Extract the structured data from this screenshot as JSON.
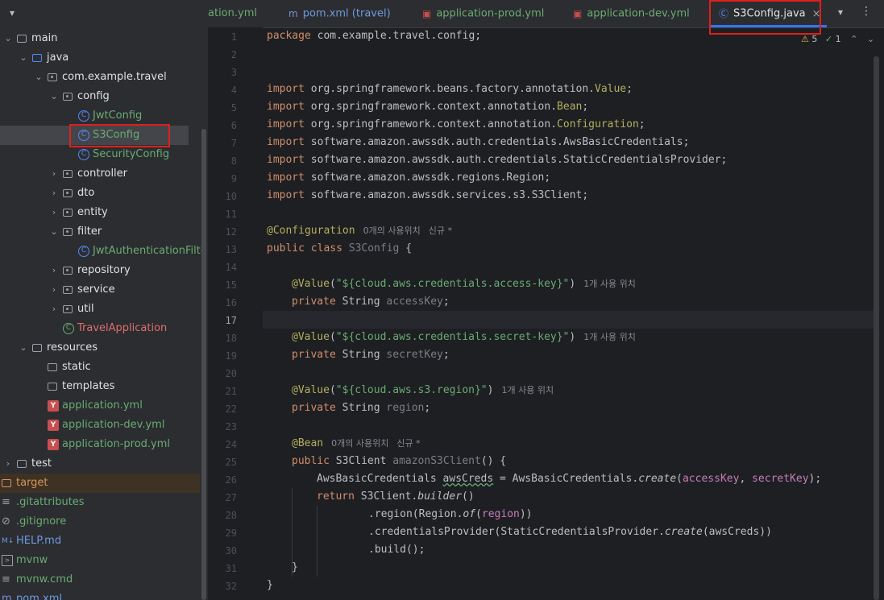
{
  "tabs": [
    {
      "label": "ation.yml",
      "icon": "yaml-file-icon",
      "active": false
    },
    {
      "label": "pom.xml (travel)",
      "icon": "maven-icon",
      "active": false
    },
    {
      "label": "application-prod.yml",
      "icon": "yaml-file-icon",
      "active": false
    },
    {
      "label": "application-dev.yml",
      "icon": "yaml-file-icon",
      "active": false
    },
    {
      "label": "S3Config.java",
      "icon": "java-class-icon",
      "active": true
    }
  ],
  "tree": [
    {
      "label": "main",
      "icon": "folder-icon",
      "expanded": true
    },
    {
      "label": "java",
      "icon": "source-folder-icon",
      "expanded": true
    },
    {
      "label": "com.example.travel",
      "icon": "package-icon",
      "expanded": true
    },
    {
      "label": "config",
      "icon": "package-icon",
      "expanded": true
    },
    {
      "label": "JwtConfig",
      "icon": "java-class-icon",
      "color": "green"
    },
    {
      "label": "S3Config",
      "icon": "java-class-icon",
      "color": "green",
      "selected": true
    },
    {
      "label": "SecurityConfig",
      "icon": "java-class-icon",
      "color": "green"
    },
    {
      "label": "controller",
      "icon": "package-icon",
      "expanded": false
    },
    {
      "label": "dto",
      "icon": "package-icon",
      "expanded": false
    },
    {
      "label": "entity",
      "icon": "package-icon",
      "expanded": false
    },
    {
      "label": "filter",
      "icon": "package-icon",
      "expanded": true
    },
    {
      "label": "JwtAuthenticationFilte",
      "icon": "java-class-icon",
      "color": "green"
    },
    {
      "label": "repository",
      "icon": "package-icon",
      "expanded": false
    },
    {
      "label": "service",
      "icon": "package-icon",
      "expanded": false
    },
    {
      "label": "util",
      "icon": "package-icon",
      "expanded": false
    },
    {
      "label": "TravelApplication",
      "icon": "spring-boot-icon",
      "color": "red"
    },
    {
      "label": "resources",
      "icon": "resources-folder-icon",
      "expanded": true
    },
    {
      "label": "static",
      "icon": "folder-icon"
    },
    {
      "label": "templates",
      "icon": "folder-icon"
    },
    {
      "label": "application.yml",
      "icon": "yaml-file-icon",
      "color": "green"
    },
    {
      "label": "application-dev.yml",
      "icon": "yaml-file-icon",
      "color": "green"
    },
    {
      "label": "application-prod.yml",
      "icon": "yaml-file-icon",
      "color": "green"
    },
    {
      "label": "test",
      "icon": "folder-icon",
      "expanded": false
    },
    {
      "label": "target",
      "icon": "excluded-folder-icon",
      "color": "orange"
    },
    {
      "label": ".gitattributes",
      "icon": "text-file-icon",
      "color": "green"
    },
    {
      "label": ".gitignore",
      "icon": "ignore-file-icon",
      "color": "green"
    },
    {
      "label": "HELP.md",
      "icon": "markdown-icon",
      "color": "blue"
    },
    {
      "label": "mvnw",
      "icon": "terminal-icon",
      "color": "green"
    },
    {
      "label": "mvnw.cmd",
      "icon": "text-file-icon",
      "color": "green"
    },
    {
      "label": "pom.xml",
      "icon": "maven-icon",
      "color": "blue"
    }
  ],
  "inspections": {
    "warnings": "5",
    "ok": "1"
  },
  "current_line": 17,
  "hints": {
    "no_usages": "0개의 사용위치",
    "new": "신규 *",
    "one_usage": "1개 사용 위치"
  },
  "code": {
    "l1_pkg": "package",
    "l1_rest": " com.example.travel.config;",
    "imports": [
      {
        "kw": "import",
        "pre": " org.springframework.beans.factory.annotation.",
        "ann": "Value",
        "post": ";"
      },
      {
        "kw": "import",
        "pre": " org.springframework.context.annotation.",
        "ann": "Bean",
        "post": ";"
      },
      {
        "kw": "import",
        "pre": " org.springframework.context.annotation.",
        "ann": "Configuration",
        "post": ";"
      },
      {
        "kw": "import",
        "pre": " software.amazon.awssdk.auth.credentials.AwsBasicCredentials;",
        "ann": "",
        "post": ""
      },
      {
        "kw": "import",
        "pre": " software.amazon.awssdk.auth.credentials.StaticCredentialsProvider;",
        "ann": "",
        "post": ""
      },
      {
        "kw": "import",
        "pre": " software.amazon.awssdk.regions.Region;",
        "ann": "",
        "post": ""
      },
      {
        "kw": "import",
        "pre": " software.amazon.awssdk.services.s3.S3Client;",
        "ann": "",
        "post": ""
      }
    ],
    "l12_ann": "@Configuration",
    "l13_kw": "public class",
    "l13_name": "S3Config",
    "l13_rest": " {",
    "ann_value": "@Value",
    "l15_str": "\"${cloud.aws.credentials.access-key}\"",
    "l16_kw": "private",
    "type_string": " String ",
    "field_access": "accessKey",
    "l18_str": "\"${cloud.aws.credentials.secret-key}\"",
    "field_secret": "secretKey",
    "l21_str": "\"${cloud.aws.s3.region}\"",
    "field_region": "region",
    "ann_bean": "@Bean",
    "l25_kw": "public",
    "l25_type": " S3Client ",
    "l25_name": "amazonS3Client",
    "l25_rest": "() {",
    "l26_a": "AwsBasicCredentials ",
    "l26_var": "awsCreds",
    "l26_b": " = AwsBasicCredentials.",
    "l26_create": "create",
    "l26_c": "(",
    "l26_d": ", ",
    "l26_e": ");",
    "l27_kw": "return",
    "l27_a": " S3Client.",
    "l27_builder": "builder",
    "l27_b": "()",
    "l28_a": ".region(Region.",
    "l28_of": "of",
    "l28_b": "(",
    "l28_c": "))",
    "l29_a": ".credentialsProvider(StaticCredentialsProvider.",
    "l29_create": "create",
    "l29_b": "(awsCreds))",
    "l30": ".build();",
    "l31": "}",
    "l32": "}",
    "semi": ";",
    "paren_open": "(",
    "paren_close": ")"
  }
}
